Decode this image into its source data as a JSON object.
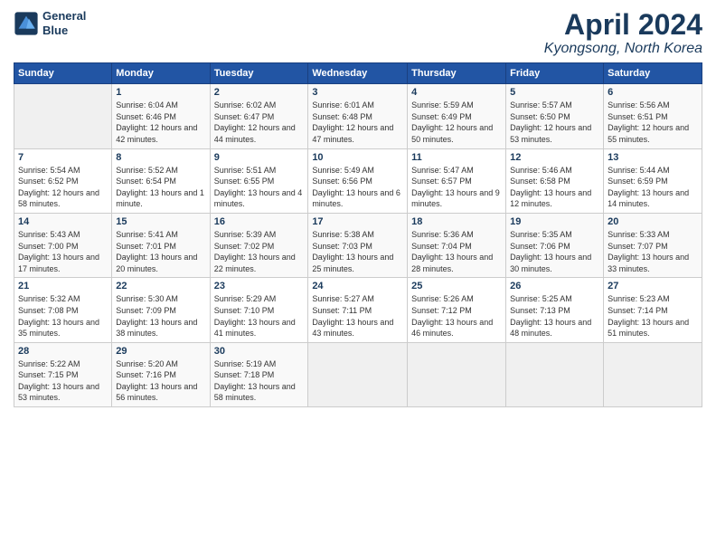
{
  "header": {
    "logo_line1": "General",
    "logo_line2": "Blue",
    "month": "April 2024",
    "location": "Kyongsong, North Korea"
  },
  "weekdays": [
    "Sunday",
    "Monday",
    "Tuesday",
    "Wednesday",
    "Thursday",
    "Friday",
    "Saturday"
  ],
  "weeks": [
    [
      {
        "day": "",
        "sunrise": "",
        "sunset": "",
        "daylight": ""
      },
      {
        "day": "1",
        "sunrise": "Sunrise: 6:04 AM",
        "sunset": "Sunset: 6:46 PM",
        "daylight": "Daylight: 12 hours and 42 minutes."
      },
      {
        "day": "2",
        "sunrise": "Sunrise: 6:02 AM",
        "sunset": "Sunset: 6:47 PM",
        "daylight": "Daylight: 12 hours and 44 minutes."
      },
      {
        "day": "3",
        "sunrise": "Sunrise: 6:01 AM",
        "sunset": "Sunset: 6:48 PM",
        "daylight": "Daylight: 12 hours and 47 minutes."
      },
      {
        "day": "4",
        "sunrise": "Sunrise: 5:59 AM",
        "sunset": "Sunset: 6:49 PM",
        "daylight": "Daylight: 12 hours and 50 minutes."
      },
      {
        "day": "5",
        "sunrise": "Sunrise: 5:57 AM",
        "sunset": "Sunset: 6:50 PM",
        "daylight": "Daylight: 12 hours and 53 minutes."
      },
      {
        "day": "6",
        "sunrise": "Sunrise: 5:56 AM",
        "sunset": "Sunset: 6:51 PM",
        "daylight": "Daylight: 12 hours and 55 minutes."
      }
    ],
    [
      {
        "day": "7",
        "sunrise": "Sunrise: 5:54 AM",
        "sunset": "Sunset: 6:52 PM",
        "daylight": "Daylight: 12 hours and 58 minutes."
      },
      {
        "day": "8",
        "sunrise": "Sunrise: 5:52 AM",
        "sunset": "Sunset: 6:54 PM",
        "daylight": "Daylight: 13 hours and 1 minute."
      },
      {
        "day": "9",
        "sunrise": "Sunrise: 5:51 AM",
        "sunset": "Sunset: 6:55 PM",
        "daylight": "Daylight: 13 hours and 4 minutes."
      },
      {
        "day": "10",
        "sunrise": "Sunrise: 5:49 AM",
        "sunset": "Sunset: 6:56 PM",
        "daylight": "Daylight: 13 hours and 6 minutes."
      },
      {
        "day": "11",
        "sunrise": "Sunrise: 5:47 AM",
        "sunset": "Sunset: 6:57 PM",
        "daylight": "Daylight: 13 hours and 9 minutes."
      },
      {
        "day": "12",
        "sunrise": "Sunrise: 5:46 AM",
        "sunset": "Sunset: 6:58 PM",
        "daylight": "Daylight: 13 hours and 12 minutes."
      },
      {
        "day": "13",
        "sunrise": "Sunrise: 5:44 AM",
        "sunset": "Sunset: 6:59 PM",
        "daylight": "Daylight: 13 hours and 14 minutes."
      }
    ],
    [
      {
        "day": "14",
        "sunrise": "Sunrise: 5:43 AM",
        "sunset": "Sunset: 7:00 PM",
        "daylight": "Daylight: 13 hours and 17 minutes."
      },
      {
        "day": "15",
        "sunrise": "Sunrise: 5:41 AM",
        "sunset": "Sunset: 7:01 PM",
        "daylight": "Daylight: 13 hours and 20 minutes."
      },
      {
        "day": "16",
        "sunrise": "Sunrise: 5:39 AM",
        "sunset": "Sunset: 7:02 PM",
        "daylight": "Daylight: 13 hours and 22 minutes."
      },
      {
        "day": "17",
        "sunrise": "Sunrise: 5:38 AM",
        "sunset": "Sunset: 7:03 PM",
        "daylight": "Daylight: 13 hours and 25 minutes."
      },
      {
        "day": "18",
        "sunrise": "Sunrise: 5:36 AM",
        "sunset": "Sunset: 7:04 PM",
        "daylight": "Daylight: 13 hours and 28 minutes."
      },
      {
        "day": "19",
        "sunrise": "Sunrise: 5:35 AM",
        "sunset": "Sunset: 7:06 PM",
        "daylight": "Daylight: 13 hours and 30 minutes."
      },
      {
        "day": "20",
        "sunrise": "Sunrise: 5:33 AM",
        "sunset": "Sunset: 7:07 PM",
        "daylight": "Daylight: 13 hours and 33 minutes."
      }
    ],
    [
      {
        "day": "21",
        "sunrise": "Sunrise: 5:32 AM",
        "sunset": "Sunset: 7:08 PM",
        "daylight": "Daylight: 13 hours and 35 minutes."
      },
      {
        "day": "22",
        "sunrise": "Sunrise: 5:30 AM",
        "sunset": "Sunset: 7:09 PM",
        "daylight": "Daylight: 13 hours and 38 minutes."
      },
      {
        "day": "23",
        "sunrise": "Sunrise: 5:29 AM",
        "sunset": "Sunset: 7:10 PM",
        "daylight": "Daylight: 13 hours and 41 minutes."
      },
      {
        "day": "24",
        "sunrise": "Sunrise: 5:27 AM",
        "sunset": "Sunset: 7:11 PM",
        "daylight": "Daylight: 13 hours and 43 minutes."
      },
      {
        "day": "25",
        "sunrise": "Sunrise: 5:26 AM",
        "sunset": "Sunset: 7:12 PM",
        "daylight": "Daylight: 13 hours and 46 minutes."
      },
      {
        "day": "26",
        "sunrise": "Sunrise: 5:25 AM",
        "sunset": "Sunset: 7:13 PM",
        "daylight": "Daylight: 13 hours and 48 minutes."
      },
      {
        "day": "27",
        "sunrise": "Sunrise: 5:23 AM",
        "sunset": "Sunset: 7:14 PM",
        "daylight": "Daylight: 13 hours and 51 minutes."
      }
    ],
    [
      {
        "day": "28",
        "sunrise": "Sunrise: 5:22 AM",
        "sunset": "Sunset: 7:15 PM",
        "daylight": "Daylight: 13 hours and 53 minutes."
      },
      {
        "day": "29",
        "sunrise": "Sunrise: 5:20 AM",
        "sunset": "Sunset: 7:16 PM",
        "daylight": "Daylight: 13 hours and 56 minutes."
      },
      {
        "day": "30",
        "sunrise": "Sunrise: 5:19 AM",
        "sunset": "Sunset: 7:18 PM",
        "daylight": "Daylight: 13 hours and 58 minutes."
      },
      {
        "day": "",
        "sunrise": "",
        "sunset": "",
        "daylight": ""
      },
      {
        "day": "",
        "sunrise": "",
        "sunset": "",
        "daylight": ""
      },
      {
        "day": "",
        "sunrise": "",
        "sunset": "",
        "daylight": ""
      },
      {
        "day": "",
        "sunrise": "",
        "sunset": "",
        "daylight": ""
      }
    ]
  ]
}
